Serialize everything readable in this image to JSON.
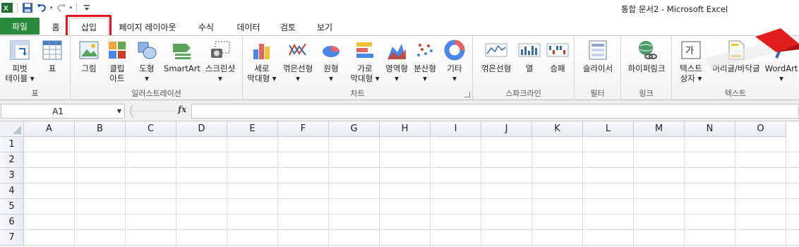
{
  "window": {
    "title": "통합 문서2  -  Microsoft Excel"
  },
  "qat": {
    "icons": [
      "excel-logo-icon",
      "save-icon",
      "undo-icon",
      "redo-icon",
      "customize-icon"
    ]
  },
  "tabs": {
    "file": "파일",
    "items": [
      "홈",
      "삽입",
      "페이지 레이아웃",
      "수식",
      "데이터",
      "검토",
      "보기"
    ],
    "active": "삽입"
  },
  "ribbon": {
    "groups": {
      "tables": {
        "label": "표",
        "pivot": "피벗\n테이블 ▾",
        "table": "표"
      },
      "illustrations": {
        "label": "일러스트레이션",
        "picture": "그림",
        "clipart": "클립\n아트",
        "shapes": "도형\n▾",
        "smartart": "SmartArt",
        "screenshot": "스크린샷\n▾"
      },
      "charts": {
        "label": "차트",
        "column": "세로\n막대형 ▾",
        "line": "꺾은선형\n▾",
        "pie": "원형\n▾",
        "bar": "가로\n막대형 ▾",
        "area": "영역형\n▾",
        "scatter": "분산형\n▾",
        "other": "기타\n▾"
      },
      "sparklines": {
        "label": "스파크라인",
        "line": "꺾은선형",
        "column": "열",
        "winloss": "승패"
      },
      "filter": {
        "label": "필터",
        "slicer": "슬라이서"
      },
      "links": {
        "label": "링크",
        "hyperlink": "하이퍼링크"
      },
      "text": {
        "label": "텍스트",
        "textbox": "텍스트\n상자 ▾",
        "headerfooter": "머리글/바닥글",
        "wordart": "WordArt\n▾"
      }
    }
  },
  "formula_bar": {
    "name_box": "A1",
    "fx": "fx",
    "formula": ""
  },
  "sheet": {
    "columns": [
      "A",
      "B",
      "C",
      "D",
      "E",
      "F",
      "G",
      "H",
      "I",
      "J",
      "K",
      "L",
      "M",
      "N",
      "O"
    ],
    "rows": [
      "1",
      "2",
      "3",
      "4",
      "5",
      "6",
      "7"
    ]
  },
  "colors": {
    "file_tab": "#2a8a3c",
    "highlight": "#e8101a"
  }
}
